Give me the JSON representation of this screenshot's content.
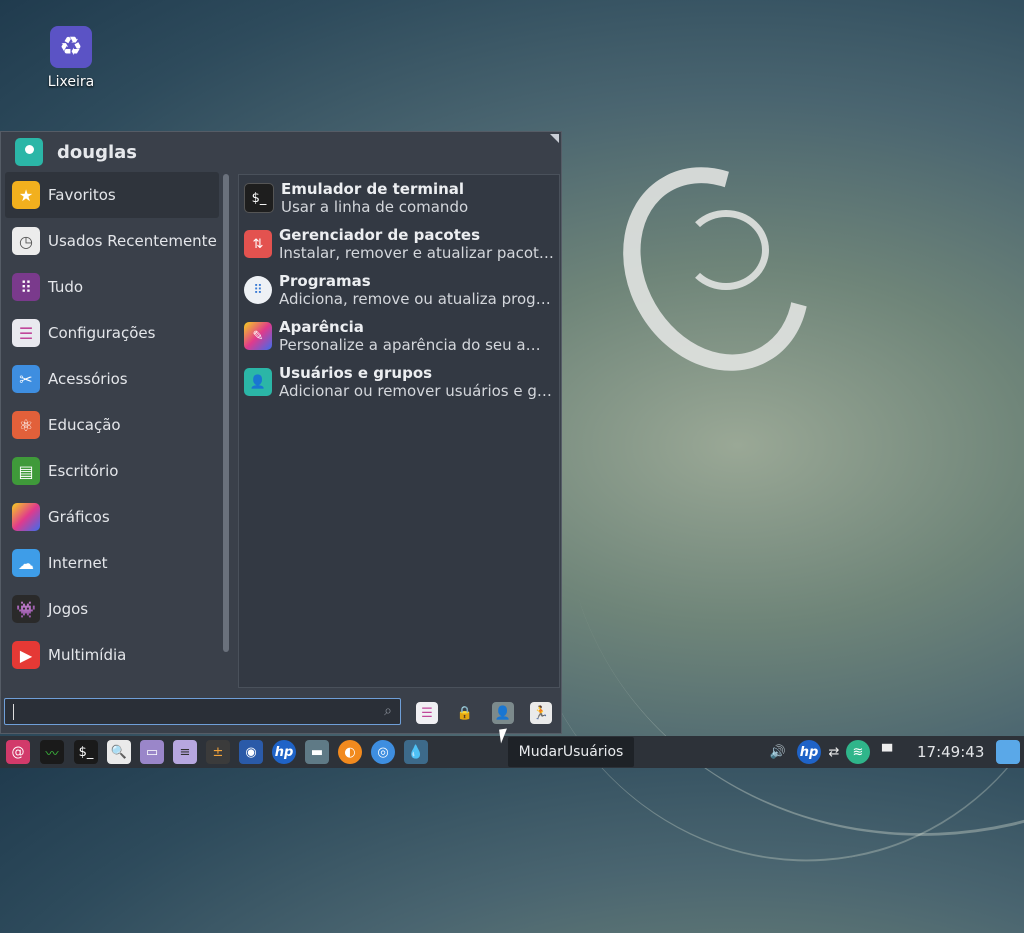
{
  "desktop": {
    "trash_label": "Lixeira"
  },
  "menu": {
    "user": "douglas",
    "categories": [
      {
        "label": "Favoritos",
        "icon": "star-icon",
        "color": "#f2b01e"
      },
      {
        "label": "Usados Recentemente",
        "icon": "clock-icon",
        "color": "#e8e8e8"
      },
      {
        "label": "Tudo",
        "icon": "grid-icon",
        "color": "#7a3a8c"
      },
      {
        "label": "Configurações",
        "icon": "toggles-icon",
        "color": "#e9e9ef"
      },
      {
        "label": "Acessórios",
        "icon": "scissors-icon",
        "color": "#3e8ee0"
      },
      {
        "label": "Educação",
        "icon": "atom-icon",
        "color": "#e2603a"
      },
      {
        "label": "Escritório",
        "icon": "document-icon",
        "color": "#3f9a3a"
      },
      {
        "label": "Gráficos",
        "icon": "palette-icon",
        "color": "#c43cc6"
      },
      {
        "label": "Internet",
        "icon": "cloud-icon",
        "color": "#3e9de8"
      },
      {
        "label": "Jogos",
        "icon": "invader-icon",
        "color": "#2a2a2a"
      },
      {
        "label": "Multimídia",
        "icon": "play-icon",
        "color": "#e53935"
      }
    ],
    "apps": [
      {
        "name": "Emulador de terminal",
        "desc": "Usar a linha de comando",
        "icon": "terminal-icon",
        "color": "#1e1e1e"
      },
      {
        "name": "Gerenciador de pacotes",
        "desc": "Instalar, remover e atualizar pacote…",
        "icon": "package-icon",
        "color": "#e3524f"
      },
      {
        "name": "Programas",
        "desc": "Adiciona, remove ou atualiza progr…",
        "icon": "apps-icon",
        "color": "#eef1f5"
      },
      {
        "name": "Aparência",
        "desc": "Personalize a aparência do seu am…",
        "icon": "brush-icon",
        "color": "#8a3ad0"
      },
      {
        "name": "Usuários e grupos",
        "desc": "Adicionar ou remover usuários e gr…",
        "icon": "user-icon",
        "color": "#2bb6a7"
      }
    ],
    "search": {
      "value": "",
      "placeholder": ""
    }
  },
  "panel": {
    "clock": "17:49:43",
    "tooltip": "MudarUsuários"
  }
}
